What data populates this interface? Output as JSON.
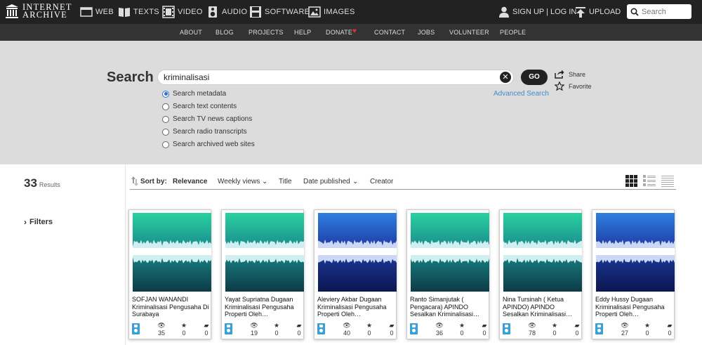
{
  "top_nav": {
    "logo_line1": "INTERNET",
    "logo_line2": "ARCHIVE",
    "media": [
      {
        "label": "WEB",
        "icon": "web-icon"
      },
      {
        "label": "TEXTS",
        "icon": "book-icon"
      },
      {
        "label": "VIDEO",
        "icon": "film-icon"
      },
      {
        "label": "AUDIO",
        "icon": "speaker-icon"
      },
      {
        "label": "SOFTWARE",
        "icon": "floppy-disk-icon"
      },
      {
        "label": "IMAGES",
        "icon": "image-icon"
      }
    ],
    "sign_in": "SIGN UP | LOG IN",
    "upload": "UPLOAD",
    "search_placeholder": "Search"
  },
  "sub_nav": [
    "ABOUT",
    "BLOG",
    "PROJECTS",
    "HELP",
    "DONATE",
    "CONTACT",
    "JOBS",
    "VOLUNTEER",
    "PEOPLE"
  ],
  "search": {
    "heading": "Search",
    "query": "kriminalisasi",
    "go_label": "GO",
    "share_label": "Share",
    "favorite_label": "Favorite",
    "advanced_label": "Advanced Search",
    "options": [
      {
        "label": "Search metadata",
        "checked": true
      },
      {
        "label": "Search text contents",
        "checked": false
      },
      {
        "label": "Search TV news captions",
        "checked": false
      },
      {
        "label": "Search radio transcripts",
        "checked": false
      },
      {
        "label": "Search archived web sites",
        "checked": false
      }
    ]
  },
  "results": {
    "count": "33",
    "count_label": "Results",
    "filters_label": "Filters"
  },
  "sort": {
    "label": "Sort by:",
    "options": [
      "Relevance",
      "Weekly views",
      "Title",
      "Date published",
      "Creator"
    ]
  },
  "items": [
    {
      "title": "SOFJAN WANANDI Kriminalisasi Pengusaha Di Surabaya",
      "views": "35",
      "favorites": "0",
      "reviews": "0",
      "palette": "teal"
    },
    {
      "title": "Yayat Supriatna Dugaan Kriminalisasi Pengusaha Properti Oleh…",
      "views": "19",
      "favorites": "0",
      "reviews": "0",
      "palette": "teal"
    },
    {
      "title": "Aleviery Akbar Dugaan Kriminalisasi Pengusaha Properti Oleh…",
      "views": "40",
      "favorites": "0",
      "reviews": "0",
      "palette": "blue"
    },
    {
      "title": "Ranto Simanjutak ( Pengacara) APINDO Sesalkan Kriminalisasi…",
      "views": "36",
      "favorites": "0",
      "reviews": "0",
      "palette": "teal"
    },
    {
      "title": "Nina Tursinah ( Ketua APINDO) APINDO Sesalkan Kriminalisasi…",
      "views": "78",
      "favorites": "0",
      "reviews": "0",
      "palette": "teal"
    },
    {
      "title": "Eddy Hussy Dugaan Kriminalisasi Pengusaha Properti Oleh…",
      "views": "27",
      "favorites": "0",
      "reviews": "0",
      "palette": "blue"
    }
  ],
  "colors": {
    "topbar": "#222222",
    "subnav": "#333333",
    "search_bg": "#dcdcdc",
    "link": "#428bca",
    "donate_heart": "#e5312f",
    "audio_badge": "#3aa0d8"
  }
}
